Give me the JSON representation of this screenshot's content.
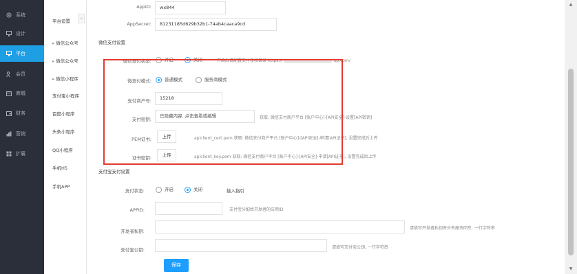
{
  "sidebar": {
    "items": [
      {
        "label": "系统",
        "icon": "gear-icon"
      },
      {
        "label": "设计",
        "icon": "monitor-icon"
      },
      {
        "label": "平台",
        "icon": "monitor-icon"
      },
      {
        "label": "会员",
        "icon": "users-icon"
      },
      {
        "label": "商城",
        "icon": "store-icon"
      },
      {
        "label": "财务",
        "icon": "wallet-icon"
      },
      {
        "label": "营销",
        "icon": "marketing-icon"
      },
      {
        "label": "扩展",
        "icon": "grid-icon"
      }
    ],
    "active_index": 2
  },
  "subnav": {
    "items": [
      "平台设置",
      "微信公众号",
      "微信公众号",
      "微信小程序",
      "支付宝小程序",
      "百度小程序",
      "头条小程序",
      "QQ小程序",
      "手机H5",
      "手机APP"
    ],
    "collapse_glyph": "«"
  },
  "form": {
    "appid_label": "AppID:",
    "appid_value": "wx844",
    "appsecret_label": "AppSecret:",
    "appsecret_value": "81231185d629b32b1-74ab4caaca9cd",
    "wxpay_section": "微信支付设置",
    "pay_status_label": "微信支付状态:",
    "pay_status_on": "开启",
    "pay_status_off": "关闭",
    "pay_status_hint": "开启后请配置支付授权目录 https://",
    "pay_status_hint_tail": "up.com/",
    "pay_mode_label": "微支付模式:",
    "pay_mode_normal": "普通模式",
    "pay_mode_service": "服务商模式",
    "mchid_label": "支付商户号:",
    "mchid_value": "15218",
    "paykey_label": "支付密钥:",
    "paykey_value": "已隐藏内容, 点击查看或编辑",
    "paykey_hint": "获取: 微信支付商户平台 [账户中心]-[API安全]-设置[API密钥]",
    "pem_label": "PEM证书:",
    "pem_button": "上传",
    "pem_hint": "apiclient_cert.pem 获取: 微信支付商户平台 [账户中心]-[API安全]-申请[API证书], 设置完成后上传",
    "cert_label": "证书密钥:",
    "cert_button": "上传",
    "cert_hint": "apiclient_key.pem 获取: 微信支付商户平台 [账户中心]-[API安全]-申请[API证书], 设置完成后上传",
    "alipay_section": "支付宝支付设置",
    "alipay_status_label": "支付状态:",
    "alipay_on": "开启",
    "alipay_off": "关闭",
    "alipay_link": "接入指引",
    "alipay_appid_label": "APPID:",
    "alipay_appid_hint": "支付宝分配给开发者的应用ID",
    "dev_privkey_label": "开发者私钥:",
    "dev_privkey_hint": "请填写开发者私钥去头去尾去回车, 一行字符串",
    "alipay_pubkey_label": "支付宝公钥:",
    "alipay_pubkey_hint": "请填写支付宝公钥, 一行字符串",
    "save_button": "保存"
  },
  "colors": {
    "sidebar_bg": "#2b2f3a",
    "active": "#1f9fe3",
    "primary": "#1e9fff",
    "highlight_box": "#e3392f"
  }
}
